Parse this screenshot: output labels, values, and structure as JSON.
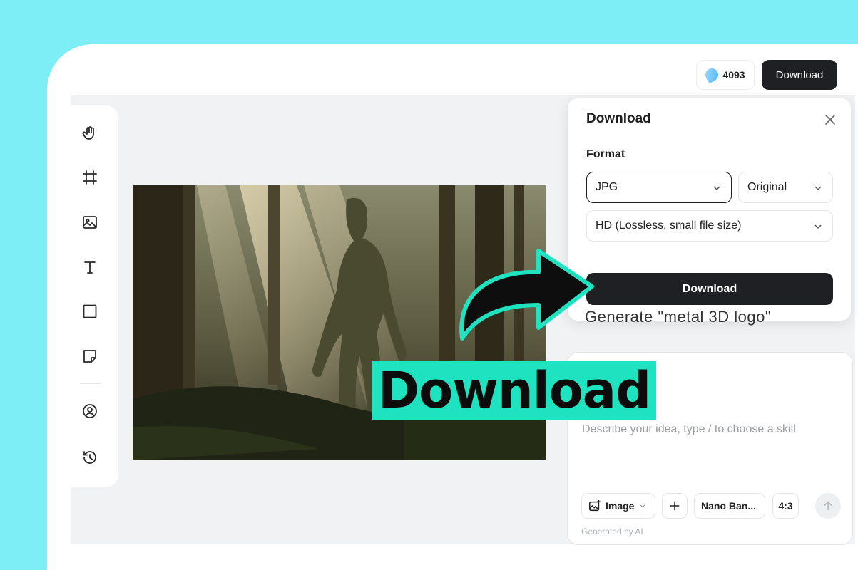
{
  "header": {
    "credits_value": "4093",
    "credits_icon": "credits-drop-icon",
    "download_label": "Download"
  },
  "toolbar": {
    "tools": [
      "hand-icon",
      "crop-frame-icon",
      "image-icon",
      "text-icon",
      "rectangle-icon",
      "sticky-note-icon",
      "user-icon",
      "history-icon"
    ]
  },
  "download_panel": {
    "title": "Download",
    "format_label": "Format",
    "format_value": "JPG",
    "size_value": "Original",
    "quality_value": "HD (Lossless, small file size)",
    "download_button": "Download"
  },
  "chat": {
    "peek_text": "Generate \"metal 3D logo\"",
    "placeholder": "Describe your idea, type / to choose a skill",
    "image_chip": "Image",
    "model_chip": "Nano Ban...",
    "ratio_chip": "4:3",
    "footer": "Generated by AI"
  },
  "overlay": {
    "word": "Download",
    "accent_color": "#1fe3c0"
  },
  "colors": {
    "background": "#7deef5",
    "dark_button": "#1f2024"
  }
}
